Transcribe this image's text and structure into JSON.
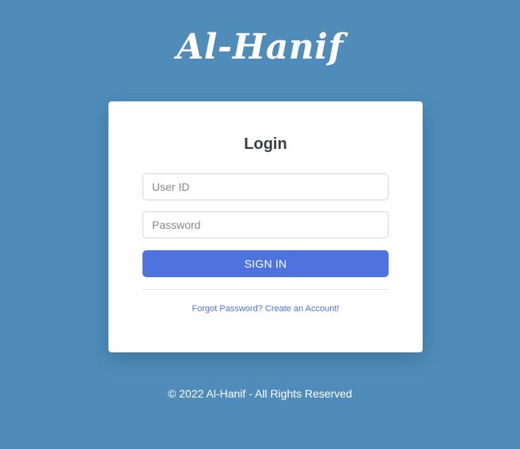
{
  "brand": {
    "logo_text": "Al-Hanif"
  },
  "login": {
    "title": "Login",
    "user_id_placeholder": "User ID",
    "password_placeholder": "Password",
    "sign_in_label": "SIGN IN",
    "forgot_password_label": "Forgot Password?",
    "create_account_label": "Create an Account!"
  },
  "footer": {
    "copyright": "© 2022 Al-Hanif - All Rights Reserved"
  },
  "colors": {
    "background": "#4f8cb9",
    "primary": "#4e73df",
    "card": "#ffffff",
    "title_text": "#3a3b45"
  }
}
